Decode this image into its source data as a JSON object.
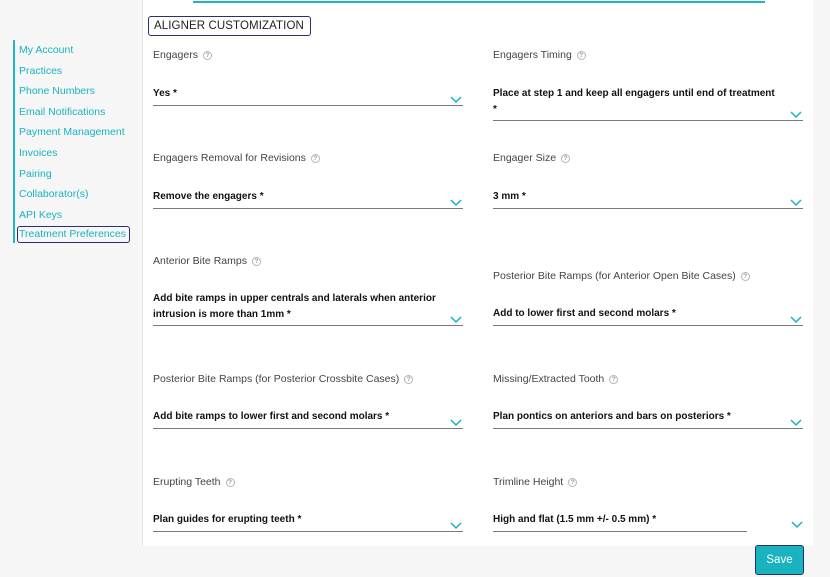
{
  "sidebar": {
    "items": [
      {
        "label": "My Account"
      },
      {
        "label": "Practices"
      },
      {
        "label": "Phone Numbers"
      },
      {
        "label": "Email Notifications"
      },
      {
        "label": "Payment Management"
      },
      {
        "label": "Invoices"
      },
      {
        "label": "Pairing"
      },
      {
        "label": "Collaborator(s)"
      },
      {
        "label": "API Keys"
      },
      {
        "label": "Treatment Preferences"
      }
    ]
  },
  "section": {
    "title": "ALIGNER CUSTOMIZATION"
  },
  "fields": [
    {
      "label": "Engagers",
      "value": "Yes *"
    },
    {
      "label": "Engagers Timing",
      "value": "Place at step 1 and keep all engagers until end of treatment *"
    },
    {
      "label": "Engagers Removal for Revisions",
      "value": "Remove the engagers *"
    },
    {
      "label": "Engager Size",
      "value": "3 mm *"
    },
    {
      "label": "Anterior Bite Ramps",
      "value": "Add bite ramps in upper centrals and laterals when anterior intrusion is more than 1mm *"
    },
    {
      "label": "Posterior Bite Ramps (for Anterior Open Bite Cases)",
      "value": "Add to lower first and second molars *"
    },
    {
      "label": "Posterior Bite Ramps (for Posterior Crossbite Cases)",
      "value": "Add bite ramps to lower first and second molars *"
    },
    {
      "label": "Missing/Extracted Tooth",
      "value": "Plan pontics on anteriors and bars on posteriors *"
    },
    {
      "label": "Erupting Teeth",
      "value": "Plan guides for erupting teeth *"
    },
    {
      "label": "Trimline Height",
      "value": "High and flat (1.5 mm +/- 0.5 mm) *"
    }
  ],
  "help_glyph": "?",
  "actions": {
    "save_label": "Save"
  },
  "colors": {
    "accent": "#19b3c0",
    "outline": "#2a2f6e"
  }
}
